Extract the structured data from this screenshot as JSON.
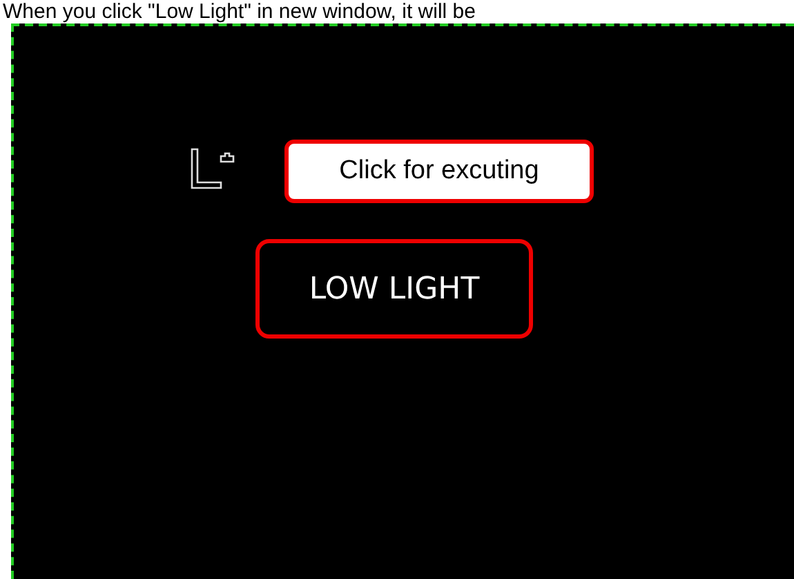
{
  "caption": "When you click \"Low Light\" in new window, it will be",
  "callout": {
    "text": "Click for excuting"
  },
  "button": {
    "label": "LOW LIGHT"
  }
}
